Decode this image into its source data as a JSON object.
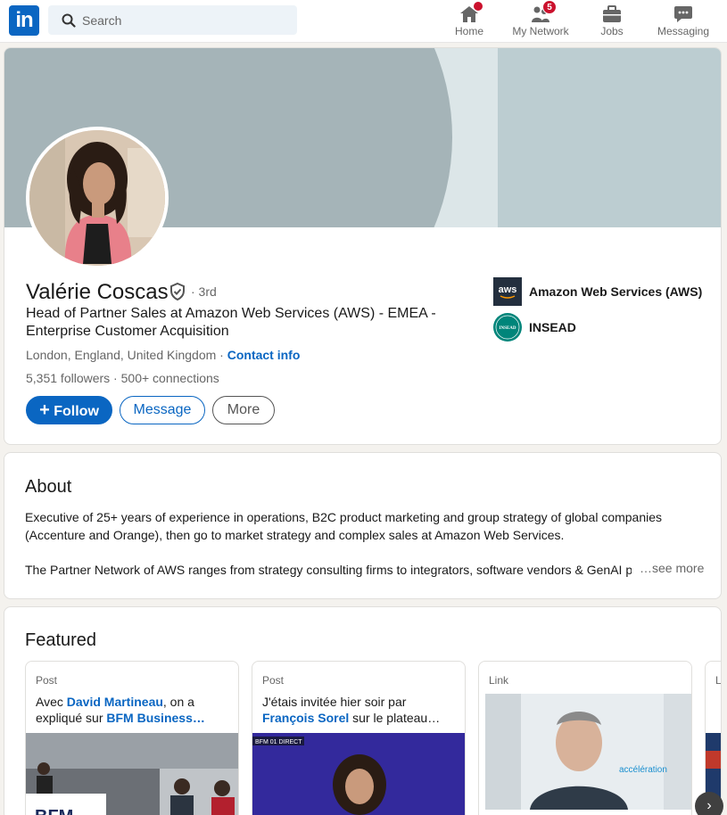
{
  "nav": {
    "logo": "in",
    "search_placeholder": "Search",
    "items": [
      {
        "label": "Home",
        "badge": ""
      },
      {
        "label": "My Network",
        "badge": "5"
      },
      {
        "label": "Jobs",
        "badge": ""
      },
      {
        "label": "Messaging",
        "badge": ""
      }
    ]
  },
  "profile": {
    "name": "Valérie Coscas",
    "degree": "· 3rd",
    "headline": "Head of Partner Sales at Amazon Web Services (AWS) - EMEA - Enterprise Customer Acquisition",
    "location": "London, England, United Kingdom",
    "location_sep": " · ",
    "contact_info": "Contact info",
    "followers": "5,351 followers",
    "connections": "500+ connections",
    "stats_sep": " · ",
    "follow_label": "Follow",
    "follow_icon": "+",
    "message_label": "Message",
    "more_label": "More",
    "orgs": [
      {
        "name": "Amazon Web Services (AWS)",
        "logo_text": "aws"
      },
      {
        "name": "INSEAD",
        "logo_text": "INSEAD"
      }
    ]
  },
  "about": {
    "title": "About",
    "paragraph1": "Executive of 25+ years of experience in operations, B2C product marketing and group strategy of global companies (Accenture and Orange), then go to market strategy and complex sales at Amazon Web Services.",
    "paragraph2": "The Partner Network of AWS ranges from strategy consulting firms to integrators, software vendors & GenAI p",
    "see_more": "…see more"
  },
  "featured": {
    "title": "Featured",
    "items": [
      {
        "kind": "Post",
        "text_a": "Avec ",
        "link_a": "David Martineau",
        "text_b": ", on a expliqué sur ",
        "link_b": "BFM Business…",
        "thumb_label": "BFM"
      },
      {
        "kind": "Post",
        "text_a": "J'étais invitée hier soir par ",
        "link_a": "François Sorel",
        "text_b": " sur le plateau…",
        "link_b": "",
        "thumb_label": "BFM 01 DIRECT"
      },
      {
        "kind": "Link",
        "text_a": "",
        "link_a": "",
        "text_b": "",
        "link_b": "",
        "thumb_label": "accélération"
      },
      {
        "kind": "L",
        "text_a": "",
        "link_a": "",
        "text_b": "",
        "link_b": "",
        "thumb_label": ""
      }
    ],
    "next_arrow": "›"
  },
  "colors": {
    "brand": "#0a66c2",
    "badge": "#cb112d",
    "cover_light": "#dce6e8",
    "cover_dark": "#a5b4b8",
    "cover_right": "#bccdd1"
  }
}
